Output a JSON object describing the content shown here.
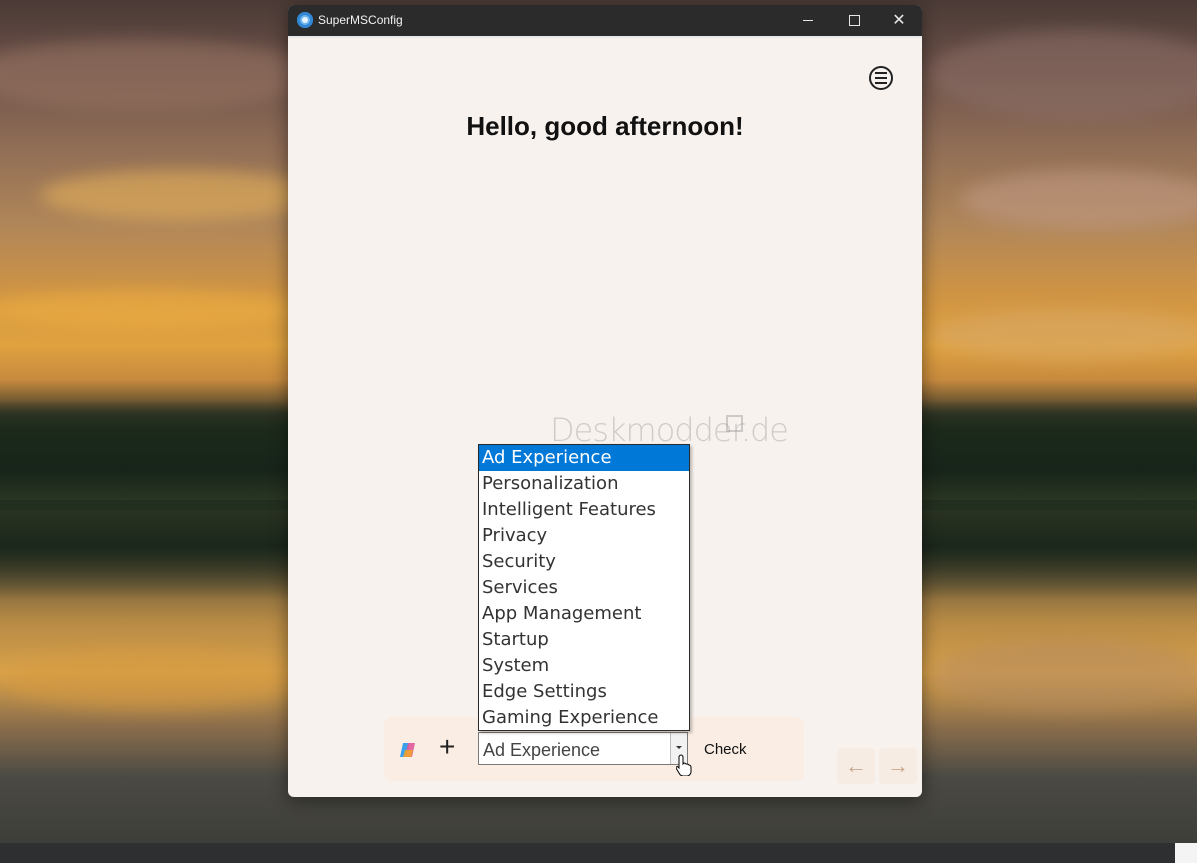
{
  "window": {
    "title": "SuperMSConfig"
  },
  "main": {
    "greeting": "Hello, good afternoon!"
  },
  "watermark": {
    "text": "Deskmodder.de"
  },
  "toolbar": {
    "combo_value": "Ad Experience",
    "check_label": "Check"
  },
  "dropdown": {
    "selected": "Ad Experience",
    "options": [
      "Ad Experience",
      "Personalization",
      "Intelligent Features",
      "Privacy",
      "Security",
      "Services",
      "App Management",
      "Startup",
      "System",
      "Edge Settings",
      "Gaming Experience"
    ]
  },
  "icons": {
    "menu": "hamburger-menu-icon",
    "copilot": "copilot-icon",
    "plus": "plus-icon",
    "back": "arrow-left-icon",
    "forward": "arrow-right-icon"
  },
  "colors": {
    "accent": "#0078d7",
    "window_bg": "#f8f2ee"
  }
}
